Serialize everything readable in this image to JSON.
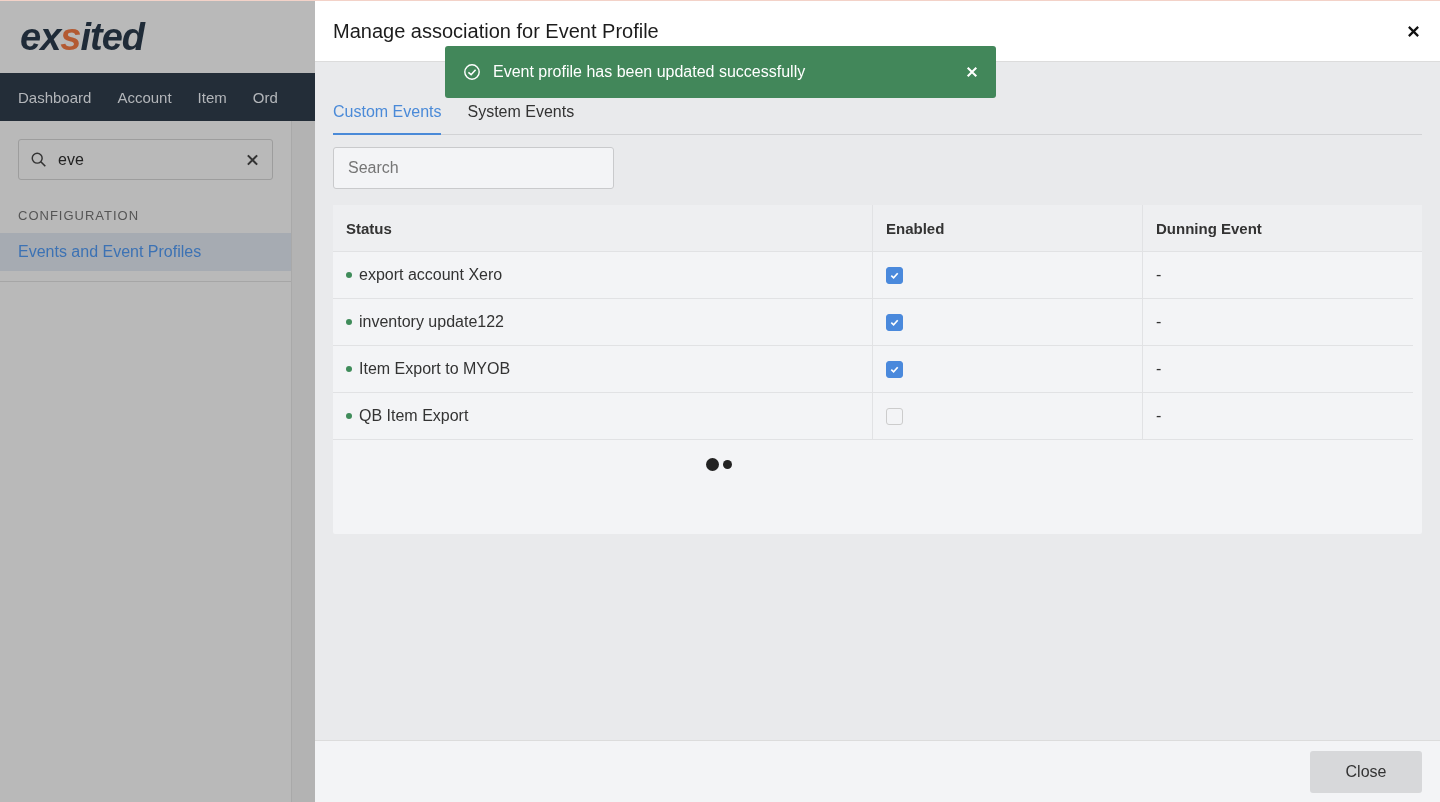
{
  "app": {
    "logo": {
      "start": "ex",
      "accent": "s",
      "end": "ited"
    },
    "nav": [
      {
        "label": "Dashboard"
      },
      {
        "label": "Account"
      },
      {
        "label": "Item"
      },
      {
        "label": "Ord"
      }
    ],
    "search": {
      "value": "eve"
    },
    "section": "CONFIGURATION",
    "menu": [
      {
        "label": "Events and Event Profiles",
        "selected": true
      }
    ]
  },
  "dialog": {
    "title": "Manage association for Event Profile",
    "toast": "Event profile has been updated successfully",
    "tabs": [
      {
        "label": "Custom Events",
        "selected": true
      },
      {
        "label": "System Events",
        "selected": false
      }
    ],
    "search": {
      "placeholder": "Search"
    },
    "table": {
      "columns": [
        "Status",
        "Enabled",
        "Dunning Event"
      ],
      "rows": [
        {
          "name": "export account Xero",
          "color": "#3f8c5a",
          "enabled": true,
          "dunning": "-"
        },
        {
          "name": "inventory update122",
          "color": "#3f8c5a",
          "enabled": true,
          "dunning": "-"
        },
        {
          "name": "Item Export to MYOB",
          "color": "#3f8c5a",
          "enabled": true,
          "dunning": "-"
        },
        {
          "name": "QB Item Export",
          "color": "#3f8c5a",
          "enabled": false,
          "dunning": "-"
        }
      ]
    },
    "buttons": [
      "Close"
    ]
  }
}
